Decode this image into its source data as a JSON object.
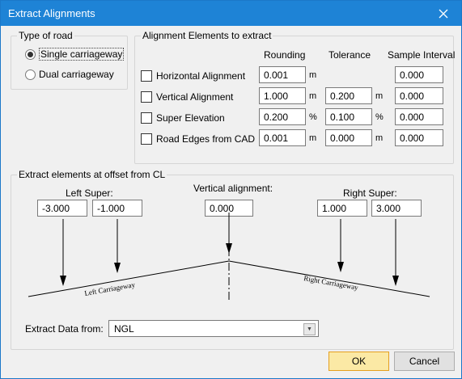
{
  "window": {
    "title": "Extract Alignments"
  },
  "road_type": {
    "legend": "Type of road",
    "options": [
      {
        "label": "Single carriageway",
        "selected": true
      },
      {
        "label": "Dual carriageway",
        "selected": false
      }
    ]
  },
  "elements": {
    "legend": "Alignment Elements to extract",
    "columns": {
      "rounding": "Rounding",
      "tolerance": "Tolerance",
      "sample": "Sample Interval"
    },
    "rows": [
      {
        "label": "Horizontal Alignment",
        "checked": false,
        "rounding": "0.001",
        "rounding_unit": "m",
        "tolerance": "",
        "tolerance_unit": "",
        "sample": "0.000"
      },
      {
        "label": "Vertical Alignment",
        "checked": false,
        "rounding": "1.000",
        "rounding_unit": "m",
        "tolerance": "0.200",
        "tolerance_unit": "m",
        "sample": "0.000"
      },
      {
        "label": "Super Elevation",
        "checked": false,
        "rounding": "0.200",
        "rounding_unit": "%",
        "tolerance": "0.100",
        "tolerance_unit": "%",
        "sample": "0.000"
      },
      {
        "label": "Road Edges from CAD",
        "checked": false,
        "rounding": "0.001",
        "rounding_unit": "m",
        "tolerance": "0.000",
        "tolerance_unit": "m",
        "sample": "0.000"
      }
    ]
  },
  "offset": {
    "legend": "Extract elements at offset from CL",
    "left_super_label": "Left Super:",
    "left_super_values": [
      "-3.000",
      "-1.000"
    ],
    "vertical_label": "Vertical alignment:",
    "vertical_value": "0.000",
    "right_super_label": "Right Super:",
    "right_super_values": [
      "1.000",
      "3.000"
    ],
    "left_carriageway": "Left Carriageway",
    "right_carriageway": "Right Carriageway",
    "extract_from_label": "Extract Data from:",
    "extract_from_value": "NGL"
  },
  "buttons": {
    "ok": "OK",
    "cancel": "Cancel"
  },
  "colors": {
    "title_bar": "#1e83d6",
    "ok_border": "#e5a020",
    "ok_fill": "#fbe9a5"
  }
}
